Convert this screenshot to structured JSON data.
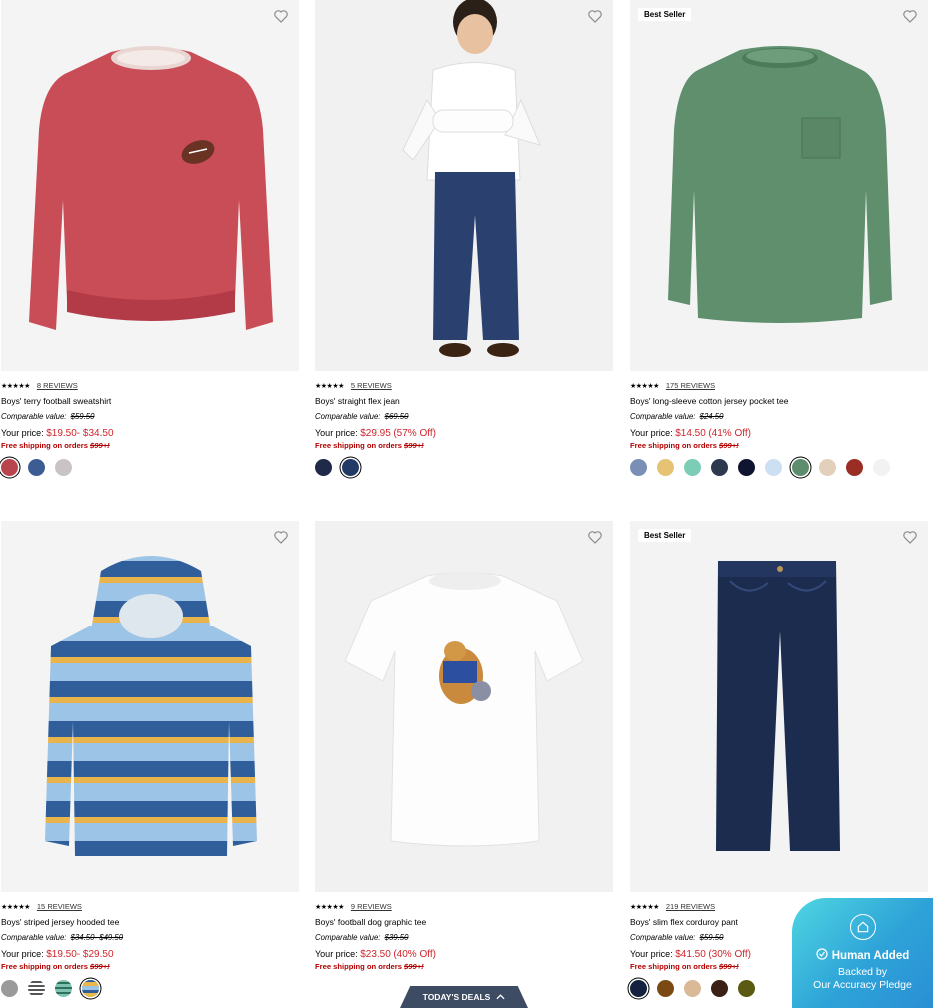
{
  "products": [
    {
      "name": "Boys' terry football sweatshirt",
      "stars": "★★★★★",
      "reviews": "8 REVIEWS",
      "badge": "",
      "comparable_label": "Comparable value:",
      "comparable_value": "$59.50",
      "your_price_label": "Your price:",
      "your_price": "$19.50- $34.50",
      "discount": "",
      "shipping": "Free shipping on orders",
      "shipping_amount": "$99+!",
      "swatches": [
        "#b8444e",
        "#3e5c94",
        "#c9c3c6"
      ]
    },
    {
      "name": "Boys' straight flex jean",
      "stars": "★★★★★",
      "reviews": "5 REVIEWS",
      "badge": "",
      "comparable_label": "Comparable value:",
      "comparable_value": "$69.50",
      "your_price_label": "Your price:",
      "your_price": "$29.95",
      "discount": "(57% Off)",
      "shipping": "Free shipping on orders",
      "shipping_amount": "$99+!",
      "swatches": [
        "#1f2a48",
        "#243a66"
      ]
    },
    {
      "name": "Boys' long-sleeve cotton jersey pocket tee",
      "stars": "★★★★★",
      "reviews": "175 REVIEWS",
      "badge": "Best Seller",
      "comparable_label": "Comparable value:",
      "comparable_value": "$24.50",
      "your_price_label": "Your price:",
      "your_price": "$14.50",
      "discount": "(41% Off)",
      "shipping": "Free shipping on orders",
      "shipping_amount": "$99+!",
      "swatches": [
        "#7a8fb5",
        "#e6c273",
        "#7ccdb6",
        "#2d3a4e",
        "#0f1530",
        "#cddff2",
        "#5e8d6e",
        "#e3d0ba",
        "#9a2e24",
        "#f2f2f2"
      ]
    },
    {
      "name": "Boys' striped jersey hooded tee",
      "stars": "★★★★★",
      "reviews": "15 REVIEWS",
      "badge": "",
      "comparable_label": "Comparable value:",
      "comparable_value": "$34.50- $49.50",
      "your_price_label": "Your price:",
      "your_price": "$19.50- $29.50",
      "discount": "",
      "shipping": "Free shipping on orders",
      "shipping_amount": "$99+!",
      "swatches": [
        "#9a9a9a",
        "#6f6f6f",
        "#4d9a88",
        "#e8b94a"
      ]
    },
    {
      "name": "Boys' football dog graphic tee",
      "stars": "★★★★★",
      "reviews": "9 REVIEWS",
      "badge": "",
      "comparable_label": "Comparable value:",
      "comparable_value": "$39.50",
      "your_price_label": "Your price:",
      "your_price": "$23.50",
      "discount": "(40% Off)",
      "shipping": "Free shipping on orders",
      "shipping_amount": "$99+!",
      "swatches": []
    },
    {
      "name": "Boys' slim flex corduroy pant",
      "stars": "★★★★★",
      "reviews": "219 REVIEWS",
      "badge": "Best Seller",
      "comparable_label": "Comparable value:",
      "comparable_value": "$59.50",
      "your_price_label": "Your price:",
      "your_price": "$41.50",
      "discount": "(30% Off)",
      "shipping": "Free shipping on orders",
      "shipping_amount": "$99+!",
      "swatches": [
        "#14213f",
        "#7a4a12",
        "#d9b996",
        "#3b2016",
        "#5a5a12"
      ]
    }
  ],
  "deals_tab": {
    "label": "TODAY'S DEALS"
  },
  "pledge": {
    "title": "Human Added",
    "line2": "Backed by",
    "line3": "Our Accuracy Pledge"
  },
  "colors": {
    "price_red": "#d0252c",
    "ship_red": "#b30000",
    "deals_bg": "#3e4c63"
  }
}
